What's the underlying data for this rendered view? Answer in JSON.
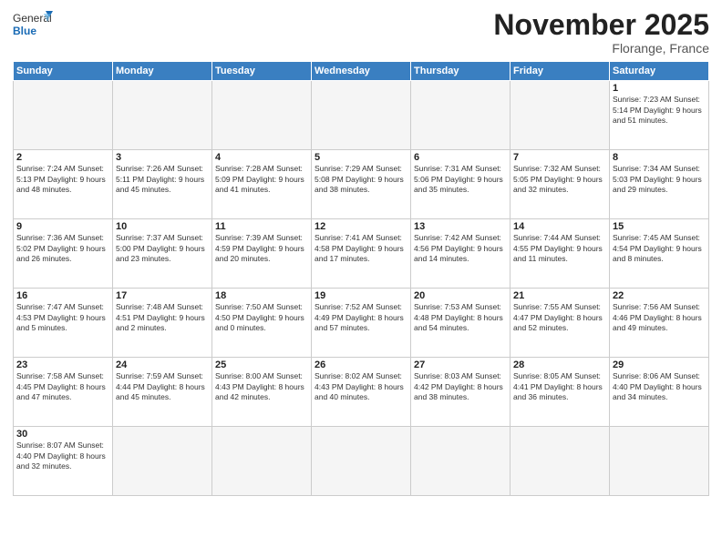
{
  "header": {
    "logo_general": "General",
    "logo_blue": "Blue",
    "month_title": "November 2025",
    "location": "Florange, France"
  },
  "days_of_week": [
    "Sunday",
    "Monday",
    "Tuesday",
    "Wednesday",
    "Thursday",
    "Friday",
    "Saturday"
  ],
  "weeks": [
    [
      {
        "day": "",
        "info": ""
      },
      {
        "day": "",
        "info": ""
      },
      {
        "day": "",
        "info": ""
      },
      {
        "day": "",
        "info": ""
      },
      {
        "day": "",
        "info": ""
      },
      {
        "day": "",
        "info": ""
      },
      {
        "day": "1",
        "info": "Sunrise: 7:23 AM\nSunset: 5:14 PM\nDaylight: 9 hours and 51 minutes."
      }
    ],
    [
      {
        "day": "2",
        "info": "Sunrise: 7:24 AM\nSunset: 5:13 PM\nDaylight: 9 hours and 48 minutes."
      },
      {
        "day": "3",
        "info": "Sunrise: 7:26 AM\nSunset: 5:11 PM\nDaylight: 9 hours and 45 minutes."
      },
      {
        "day": "4",
        "info": "Sunrise: 7:28 AM\nSunset: 5:09 PM\nDaylight: 9 hours and 41 minutes."
      },
      {
        "day": "5",
        "info": "Sunrise: 7:29 AM\nSunset: 5:08 PM\nDaylight: 9 hours and 38 minutes."
      },
      {
        "day": "6",
        "info": "Sunrise: 7:31 AM\nSunset: 5:06 PM\nDaylight: 9 hours and 35 minutes."
      },
      {
        "day": "7",
        "info": "Sunrise: 7:32 AM\nSunset: 5:05 PM\nDaylight: 9 hours and 32 minutes."
      },
      {
        "day": "8",
        "info": "Sunrise: 7:34 AM\nSunset: 5:03 PM\nDaylight: 9 hours and 29 minutes."
      }
    ],
    [
      {
        "day": "9",
        "info": "Sunrise: 7:36 AM\nSunset: 5:02 PM\nDaylight: 9 hours and 26 minutes."
      },
      {
        "day": "10",
        "info": "Sunrise: 7:37 AM\nSunset: 5:00 PM\nDaylight: 9 hours and 23 minutes."
      },
      {
        "day": "11",
        "info": "Sunrise: 7:39 AM\nSunset: 4:59 PM\nDaylight: 9 hours and 20 minutes."
      },
      {
        "day": "12",
        "info": "Sunrise: 7:41 AM\nSunset: 4:58 PM\nDaylight: 9 hours and 17 minutes."
      },
      {
        "day": "13",
        "info": "Sunrise: 7:42 AM\nSunset: 4:56 PM\nDaylight: 9 hours and 14 minutes."
      },
      {
        "day": "14",
        "info": "Sunrise: 7:44 AM\nSunset: 4:55 PM\nDaylight: 9 hours and 11 minutes."
      },
      {
        "day": "15",
        "info": "Sunrise: 7:45 AM\nSunset: 4:54 PM\nDaylight: 9 hours and 8 minutes."
      }
    ],
    [
      {
        "day": "16",
        "info": "Sunrise: 7:47 AM\nSunset: 4:53 PM\nDaylight: 9 hours and 5 minutes."
      },
      {
        "day": "17",
        "info": "Sunrise: 7:48 AM\nSunset: 4:51 PM\nDaylight: 9 hours and 2 minutes."
      },
      {
        "day": "18",
        "info": "Sunrise: 7:50 AM\nSunset: 4:50 PM\nDaylight: 9 hours and 0 minutes."
      },
      {
        "day": "19",
        "info": "Sunrise: 7:52 AM\nSunset: 4:49 PM\nDaylight: 8 hours and 57 minutes."
      },
      {
        "day": "20",
        "info": "Sunrise: 7:53 AM\nSunset: 4:48 PM\nDaylight: 8 hours and 54 minutes."
      },
      {
        "day": "21",
        "info": "Sunrise: 7:55 AM\nSunset: 4:47 PM\nDaylight: 8 hours and 52 minutes."
      },
      {
        "day": "22",
        "info": "Sunrise: 7:56 AM\nSunset: 4:46 PM\nDaylight: 8 hours and 49 minutes."
      }
    ],
    [
      {
        "day": "23",
        "info": "Sunrise: 7:58 AM\nSunset: 4:45 PM\nDaylight: 8 hours and 47 minutes."
      },
      {
        "day": "24",
        "info": "Sunrise: 7:59 AM\nSunset: 4:44 PM\nDaylight: 8 hours and 45 minutes."
      },
      {
        "day": "25",
        "info": "Sunrise: 8:00 AM\nSunset: 4:43 PM\nDaylight: 8 hours and 42 minutes."
      },
      {
        "day": "26",
        "info": "Sunrise: 8:02 AM\nSunset: 4:43 PM\nDaylight: 8 hours and 40 minutes."
      },
      {
        "day": "27",
        "info": "Sunrise: 8:03 AM\nSunset: 4:42 PM\nDaylight: 8 hours and 38 minutes."
      },
      {
        "day": "28",
        "info": "Sunrise: 8:05 AM\nSunset: 4:41 PM\nDaylight: 8 hours and 36 minutes."
      },
      {
        "day": "29",
        "info": "Sunrise: 8:06 AM\nSunset: 4:40 PM\nDaylight: 8 hours and 34 minutes."
      }
    ],
    [
      {
        "day": "30",
        "info": "Sunrise: 8:07 AM\nSunset: 4:40 PM\nDaylight: 8 hours and 32 minutes."
      },
      {
        "day": "",
        "info": ""
      },
      {
        "day": "",
        "info": ""
      },
      {
        "day": "",
        "info": ""
      },
      {
        "day": "",
        "info": ""
      },
      {
        "day": "",
        "info": ""
      },
      {
        "day": "",
        "info": ""
      }
    ]
  ]
}
